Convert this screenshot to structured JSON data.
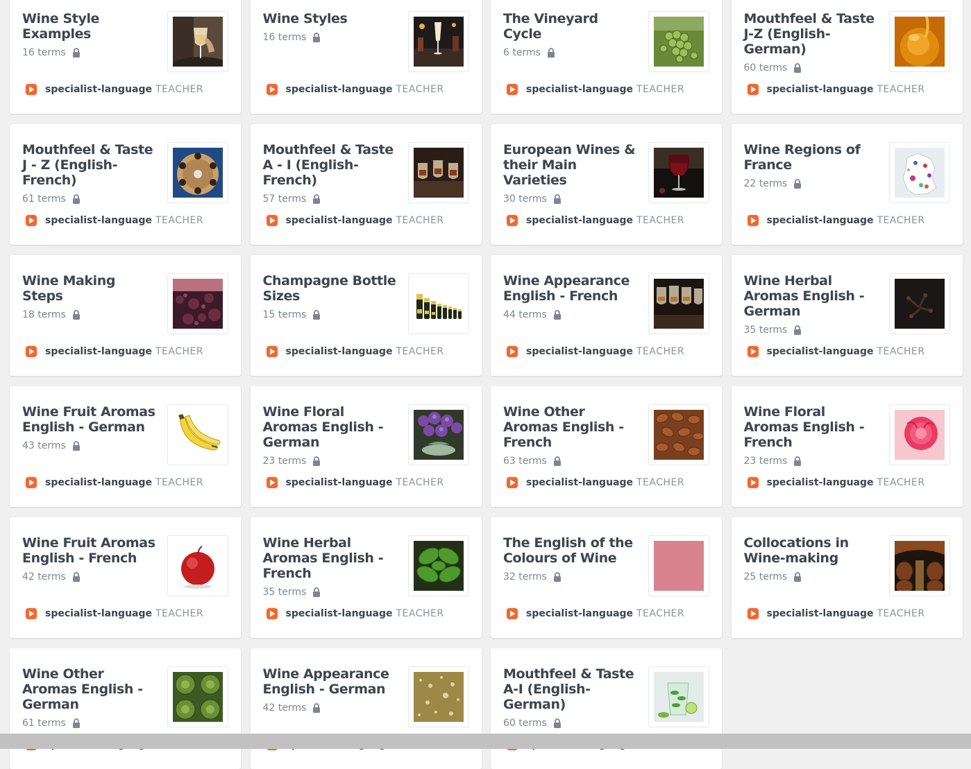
{
  "creator": {
    "name": "specialist-language",
    "role": "TEACHER"
  },
  "sets": [
    {
      "title": "Wine Style Examples",
      "terms": "16 terms",
      "thumb": "wine-glass-hand"
    },
    {
      "title": "Wine Styles",
      "terms": "16 terms",
      "thumb": "champagne-bar"
    },
    {
      "title": "The Vineyard Cycle",
      "terms": "6 terms",
      "thumb": "green-grapes"
    },
    {
      "title": "Mouthfeel & Taste J-Z (English-German)",
      "terms": "60 terms",
      "thumb": "honey"
    },
    {
      "title": "Mouthfeel & Taste J - Z (English-French)",
      "terms": "61 terms",
      "thumb": "wine-tasting-table"
    },
    {
      "title": "Mouthfeel & Taste A - I (English-French)",
      "terms": "57 terms",
      "thumb": "tasting-glasses"
    },
    {
      "title": "European Wines & their Main Varieties",
      "terms": "30 terms",
      "thumb": "red-wine-glass"
    },
    {
      "title": "Wine Regions of France",
      "terms": "22 terms",
      "thumb": "france-map"
    },
    {
      "title": "Wine Making Steps",
      "terms": "18 terms",
      "thumb": "crushed-grapes"
    },
    {
      "title": "Champagne Bottle Sizes",
      "terms": "15 terms",
      "thumb": "champagne-bottles"
    },
    {
      "title": "Wine Appearance English - French",
      "terms": "44 terms",
      "thumb": "wine-glasses-row"
    },
    {
      "title": "Wine Herbal Aromas English - German",
      "terms": "35 terms",
      "thumb": "cloves"
    },
    {
      "title": "Wine Fruit Aromas English - German",
      "terms": "43 terms",
      "thumb": "bananas"
    },
    {
      "title": "Wine Floral Aromas English - German",
      "terms": "23 terms",
      "thumb": "lilac-flowers"
    },
    {
      "title": "Wine Other Aromas English - French",
      "terms": "63 terms",
      "thumb": "almonds"
    },
    {
      "title": "Wine Floral Aromas English - French",
      "terms": "23 terms",
      "thumb": "pink-peony"
    },
    {
      "title": "Wine Fruit Aromas English - French",
      "terms": "42 terms",
      "thumb": "red-apple"
    },
    {
      "title": "Wine Herbal Aromas English - French",
      "terms": "35 terms",
      "thumb": "basil"
    },
    {
      "title": "The English of the Colours of Wine",
      "terms": "32 terms",
      "thumb": "rose-colour-swatch"
    },
    {
      "title": "Collocations in Wine-making",
      "terms": "25 terms",
      "thumb": "barrel-cellar"
    },
    {
      "title": "Wine Other Aromas English - German",
      "terms": "61 terms",
      "thumb": "artichokes"
    },
    {
      "title": "Wine Appearance English - German",
      "terms": "42 terms",
      "thumb": "sparkling-gold"
    },
    {
      "title": "Mouthfeel & Taste A-I (English-German)",
      "terms": "60 terms",
      "thumb": "mojito-glass"
    }
  ]
}
